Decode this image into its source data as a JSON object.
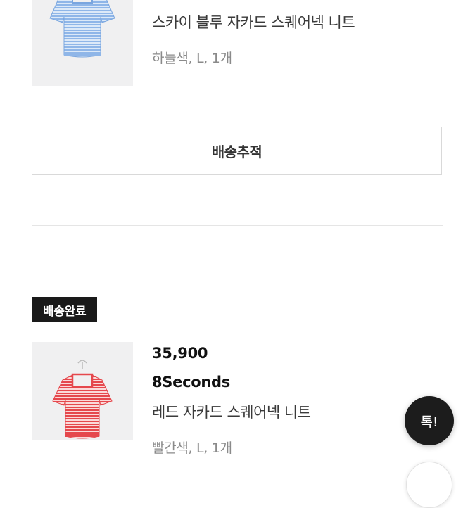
{
  "orders": [
    {
      "name": "스카이 블루 자카드 스퀘어넥 니트",
      "option": "하늘색, L, 1개",
      "colors": {
        "stripe": "#8fb6e8",
        "base": "#dce9f8"
      }
    },
    {
      "status": "배송완료",
      "price": "35,900",
      "brand": "8Seconds",
      "name": "레드 자카드 스퀘어넥 니트",
      "option": "빨간색, L, 1개",
      "colors": {
        "stripe": "#e5484d",
        "base": "#fbd9d9"
      }
    }
  ],
  "track_button": {
    "label": "배송추적"
  },
  "floating": {
    "talk_label": "톡!",
    "talk_icon": "chat-bubble-icon",
    "scroll_icon": "scroll-top-icon"
  }
}
